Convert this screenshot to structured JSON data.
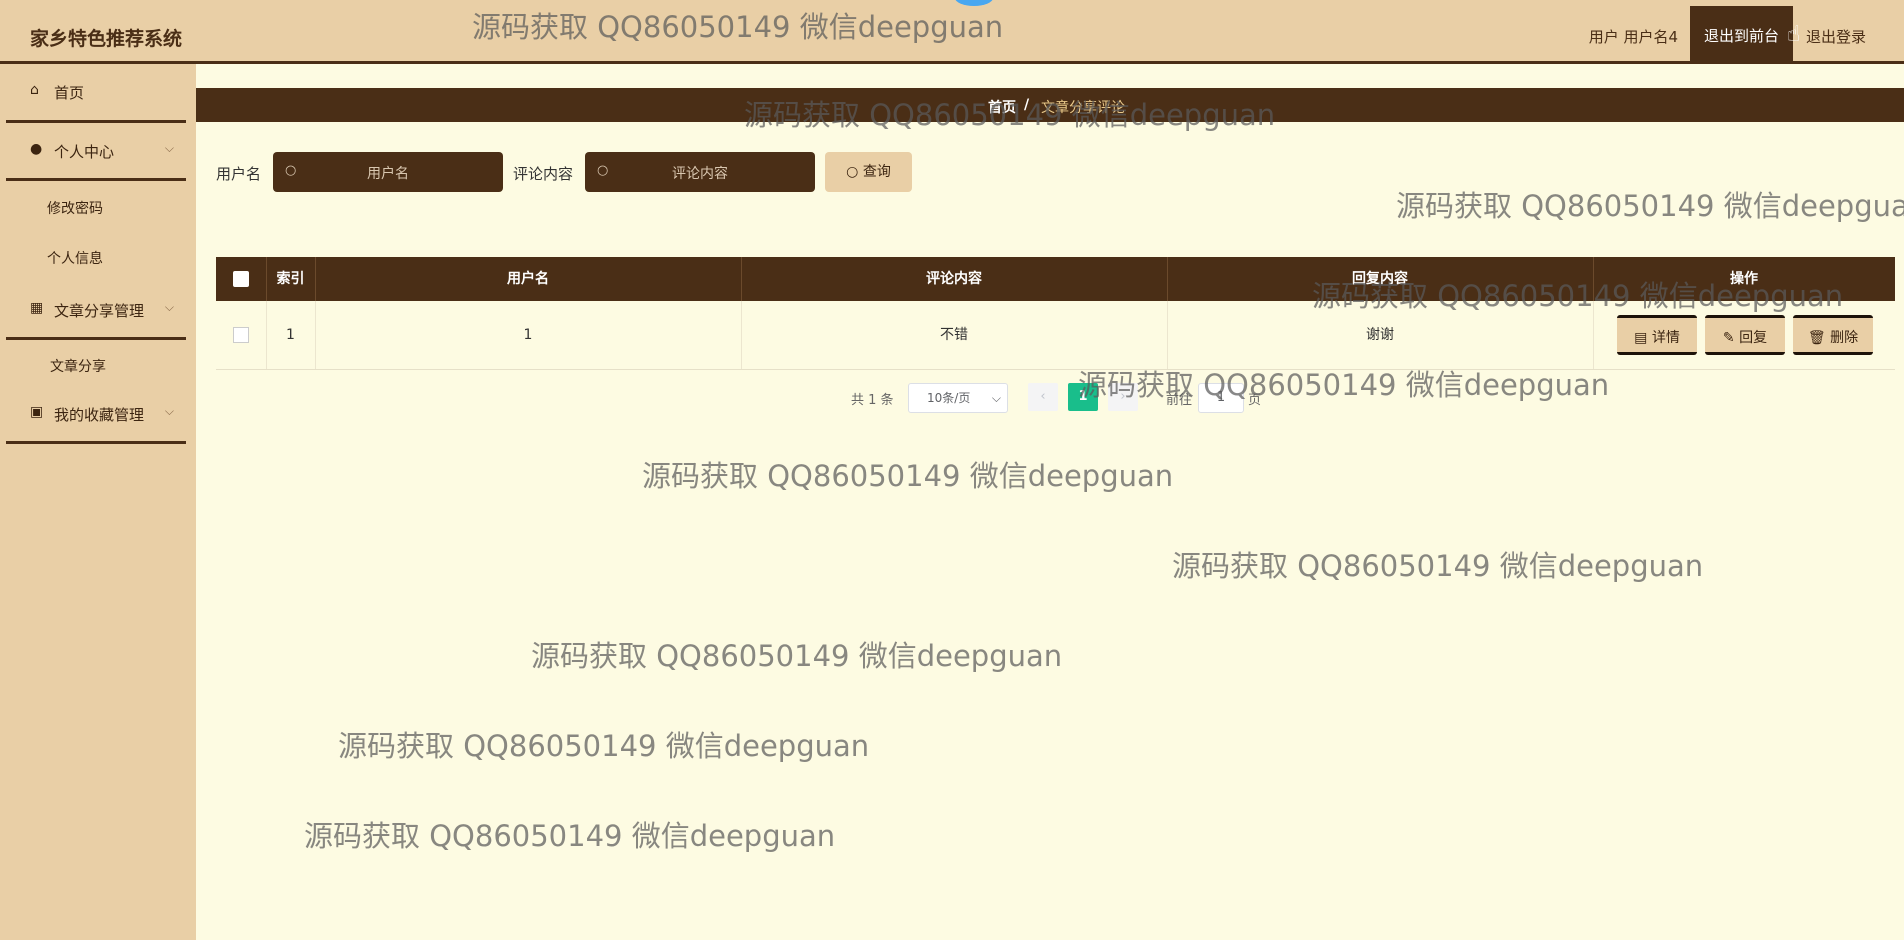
{
  "header": {
    "title": "家乡特色推荐系统",
    "user": "用户 用户名4",
    "to_front": "退出到前台",
    "logout": "退出登录"
  },
  "sidebar": {
    "items": [
      {
        "label": "首页",
        "icon": "home-icon"
      },
      {
        "label": "个人中心",
        "icon": "user-icon"
      },
      {
        "label": "文章分享管理",
        "icon": "grid-icon"
      },
      {
        "label": "我的收藏管理",
        "icon": "clipboard-icon"
      }
    ],
    "sub_items": [
      "修改密码",
      "个人信息",
      "文章分享"
    ]
  },
  "breadcrumb": {
    "home": "首页",
    "separator": "/",
    "current": "文章分享评论"
  },
  "search": {
    "username_label": "用户名",
    "username_placeholder": "用户名",
    "comment_label": "评论内容",
    "comment_placeholder": "评论内容",
    "query_button": "查询"
  },
  "table": {
    "columns": [
      "索引",
      "用户名",
      "评论内容",
      "回复内容",
      "操作"
    ],
    "rows": [
      {
        "index": "1",
        "username": "1",
        "comment": "不错",
        "reply": "谢谢"
      }
    ],
    "actions": [
      "详情",
      "回复",
      "删除"
    ]
  },
  "pagination": {
    "total": "共 1 条",
    "page_size": "10条/页",
    "current_page": "1",
    "goto_label": "前往",
    "goto_value": "1",
    "page_suffix": "页"
  },
  "watermark": "源码获取 QQ86050149 微信deepguan",
  "colors": {
    "dark_brown": "#4a2e16",
    "tan": "#e9cfa6",
    "background": "#fdfbe2",
    "accent_green": "#19be8b"
  }
}
